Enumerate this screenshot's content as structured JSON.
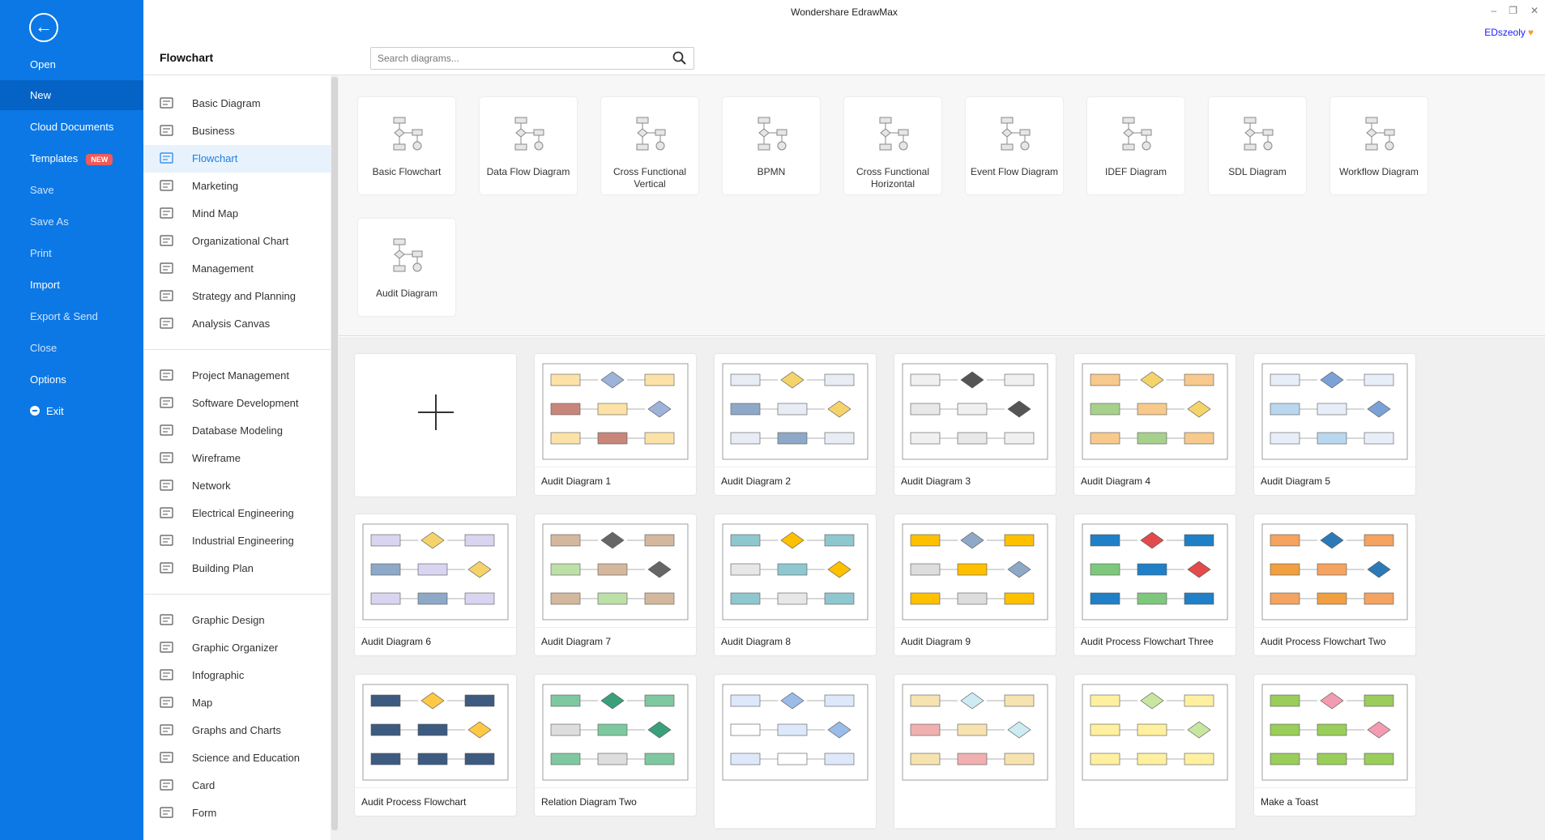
{
  "window": {
    "title": "Wondershare EdrawMax",
    "user": "EDszeoly",
    "minimize": "–",
    "restore": "❐",
    "close": "✕"
  },
  "nav": {
    "back_icon": "arrow-left-icon",
    "items": [
      {
        "label": "Open"
      },
      {
        "label": "New",
        "active": true
      },
      {
        "label": "Cloud Documents"
      },
      {
        "label": "Templates",
        "badge": "NEW"
      },
      {
        "label": "Save",
        "dim": true
      },
      {
        "label": "Save As",
        "dim": true
      },
      {
        "label": "Print",
        "dim": true
      },
      {
        "label": "Import"
      },
      {
        "label": "Export & Send",
        "dim": true
      },
      {
        "label": "Close",
        "dim": true
      },
      {
        "label": "Options"
      },
      {
        "label": "Exit"
      }
    ]
  },
  "category_panel": {
    "title": "Flowchart",
    "search_placeholder": "Search diagrams...",
    "groups": [
      [
        "Basic Diagram",
        "Business",
        "Flowchart",
        "Marketing",
        "Mind Map",
        "Organizational Chart",
        "Management",
        "Strategy and Planning",
        "Analysis Canvas"
      ],
      [
        "Project Management",
        "Software Development",
        "Database Modeling",
        "Wireframe",
        "Network",
        "Electrical Engineering",
        "Industrial Engineering",
        "Building Plan"
      ],
      [
        "Graphic Design",
        "Graphic Organizer",
        "Infographic",
        "Map",
        "Graphs and Charts",
        "Science and Education",
        "Card",
        "Form"
      ]
    ],
    "active": "Flowchart"
  },
  "diagram_types": [
    "Basic Flowchart",
    "Data Flow Diagram",
    "Cross Functional Vertical",
    "BPMN",
    "Cross Functional Horizontal",
    "Event Flow Diagram",
    "IDEF Diagram",
    "SDL Diagram",
    "Workflow Diagram",
    "Audit Diagram"
  ],
  "templates": [
    "",
    "Audit Diagram 1",
    "Audit Diagram 2",
    "Audit Diagram 3",
    "Audit Diagram 4",
    "Audit Diagram 5",
    "Audit Diagram 6",
    "Audit Diagram 7",
    "Audit Diagram 8",
    "Audit Diagram 9",
    "Audit Process Flowchart Three",
    "Audit Process Flowchart Two",
    "Audit Process Flowchart",
    "Relation Diagram Two",
    "",
    "",
    "",
    "Make a Toast"
  ],
  "colors": {
    "nav": "#0b78e6",
    "accent": "#1a7fe8",
    "badge": "#f05a5a"
  }
}
